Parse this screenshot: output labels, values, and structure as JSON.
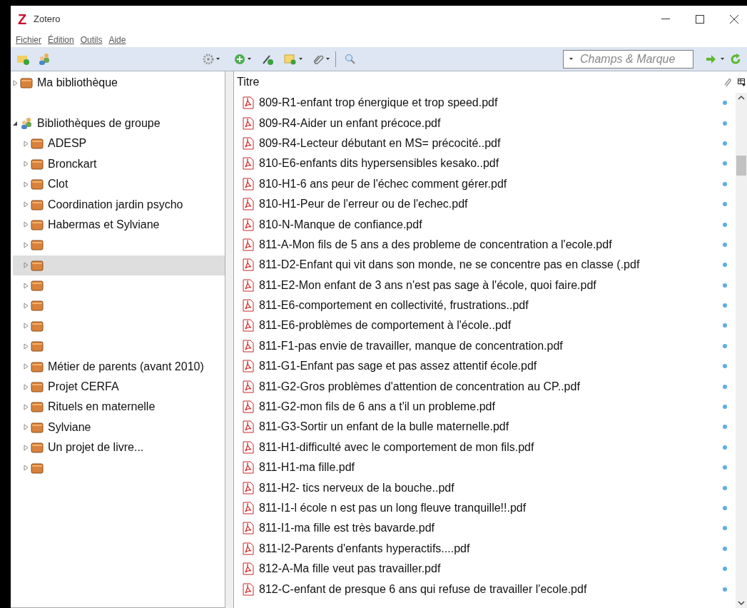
{
  "window": {
    "logo": "Z",
    "title": "Zotero"
  },
  "menu": [
    {
      "label": "Fichier"
    },
    {
      "label": "Édition"
    },
    {
      "label": "Outils"
    },
    {
      "label": "Aide"
    }
  ],
  "search": {
    "placeholder": "Champs & Marque"
  },
  "sidebar": {
    "items": [
      {
        "kind": "library",
        "label": "Ma bibliothèque",
        "expanded": false,
        "highlighted": false
      },
      {
        "kind": "spacer"
      },
      {
        "kind": "group-root",
        "label": "Bibliothèques de groupe",
        "expanded": true,
        "highlighted": false,
        "children": [
          {
            "kind": "collection",
            "label": "ADESP",
            "expanded": false,
            "highlighted": false
          },
          {
            "kind": "collection",
            "label": "Bronckart",
            "expanded": false,
            "highlighted": false
          },
          {
            "kind": "collection",
            "label": "Clot",
            "expanded": false,
            "highlighted": false
          },
          {
            "kind": "collection",
            "label": "Coordination jardin psycho",
            "expanded": false,
            "highlighted": false
          },
          {
            "kind": "collection",
            "label": "Habermas et Sylviane",
            "expanded": false,
            "highlighted": false
          },
          {
            "kind": "collection",
            "expanded": false,
            "highlighted": false
          },
          {
            "kind": "collection",
            "expanded": false,
            "highlighted": true
          },
          {
            "kind": "collection",
            "expanded": false,
            "highlighted": false
          },
          {
            "kind": "collection",
            "expanded": false,
            "highlighted": false
          },
          {
            "kind": "collection",
            "expanded": false,
            "highlighted": false
          },
          {
            "kind": "collection",
            "expanded": false,
            "highlighted": false
          },
          {
            "kind": "collection",
            "label": "Métier de parents (avant 2010)",
            "expanded": false,
            "highlighted": false
          },
          {
            "kind": "collection",
            "label": "Projet CERFA",
            "expanded": false,
            "highlighted": false
          },
          {
            "kind": "collection",
            "label": "Rituels en maternelle",
            "expanded": false,
            "highlighted": false
          },
          {
            "kind": "collection",
            "label": "Sylviane",
            "expanded": false,
            "highlighted": false
          },
          {
            "kind": "collection",
            "label": "Un projet de livre...",
            "expanded": false,
            "highlighted": false
          },
          {
            "kind": "collection",
            "expanded": false,
            "highlighted": false
          }
        ]
      }
    ]
  },
  "table": {
    "columns": [
      "Titre"
    ],
    "rows": [
      "809-R1-enfant trop énergique et trop speed.pdf",
      "809-R4-Aider un enfant précoce.pdf",
      "809-R4-Lecteur débutant en MS= précocité..pdf",
      "810-E6-enfants dits hypersensibles kesako..pdf",
      "810-H1-6 ans peur de l'échec comment gérer.pdf",
      "810-H1-Peur de l'erreur ou de l'echec.pdf",
      "810-N-Manque de confiance.pdf",
      "811-A-Mon fils de 5 ans a des probleme de concentration a l'ecole.pdf",
      "811-D2-Enfant qui vit dans son monde, ne se concentre pas en classe (.pdf",
      "811-E2-Mon enfant de 3 ans n'est pas sage à l'école, quoi faire.pdf",
      "811-E6-comportement en collectivité, frustrations..pdf",
      "811-E6-problèmes de comportement à l'école..pdf",
      "811-F1-pas envie de travailler, manque de concentration.pdf",
      "811-G1-Enfant pas sage et pas assez attentif école.pdf",
      "811-G2-Gros problèmes d'attention de concentration au CP..pdf",
      "811-G2-mon fils de 6 ans a t'il un probleme.pdf",
      "811-G3-Sortir un enfant de la bulle maternelle.pdf",
      "811-H1-difficulté avec le comportement de mon fils.pdf",
      "811-H1-ma fille.pdf",
      "811-H2- tics nerveux de la bouche..pdf",
      "811-I1-l école n est pas un long fleuve tranquille!!.pdf",
      "811-I1-ma fille est très bavarde.pdf",
      "811-I2-Parents d'enfants hyperactifs....pdf",
      "812-A-Ma fille veut pas travailler.pdf",
      "812-C-enfant de presque 6 ans qui refuse de travailler l'ecole.pdf"
    ]
  }
}
